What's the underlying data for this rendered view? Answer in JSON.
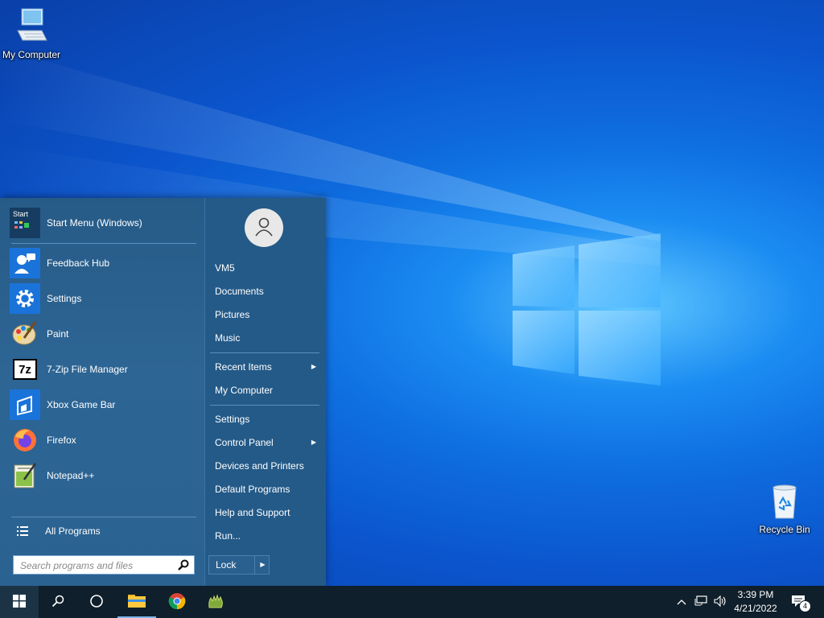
{
  "desktop": {
    "icons": [
      {
        "label": "My Computer",
        "icon": "computer-icon"
      },
      {
        "label": "Recycle Bin",
        "icon": "recycle-bin-icon"
      }
    ]
  },
  "start_menu": {
    "pinned": [
      {
        "label": "Start Menu (Windows)",
        "icon": "start-menu-app-icon"
      },
      {
        "label": "Feedback Hub",
        "icon": "feedback-hub-icon"
      },
      {
        "label": "Settings",
        "icon": "gear-icon"
      },
      {
        "label": "Paint",
        "icon": "paint-palette-icon"
      },
      {
        "label": "7-Zip File Manager",
        "icon": "7zip-icon"
      },
      {
        "label": "Xbox Game Bar",
        "icon": "xbox-game-bar-icon"
      },
      {
        "label": "Firefox",
        "icon": "firefox-icon"
      },
      {
        "label": "Notepad++",
        "icon": "notepadpp-icon"
      }
    ],
    "start_tile_text": "Start",
    "sevenzip_text": "7z",
    "all_programs": "All Programs",
    "search_placeholder": "Search programs and files",
    "right": {
      "user": "VM5",
      "documents": "Documents",
      "pictures": "Pictures",
      "music": "Music",
      "recent_items": "Recent Items",
      "my_computer": "My Computer",
      "settings": "Settings",
      "control_panel": "Control Panel",
      "devices_printers": "Devices and Printers",
      "default_programs": "Default Programs",
      "help_support": "Help and Support",
      "run": "Run..."
    },
    "lock": "Lock"
  },
  "taskbar": {
    "apps": [
      "windows-start-icon",
      "search-icon",
      "task-view-icon",
      "file-explorer-icon",
      "chrome-icon",
      "classic-shell-icon"
    ],
    "tray": {
      "time": "3:39 PM",
      "date": "4/21/2022",
      "notifications": "4"
    }
  },
  "colors": {
    "accent": "#2d6594",
    "taskbar": "#0f1f2b"
  }
}
